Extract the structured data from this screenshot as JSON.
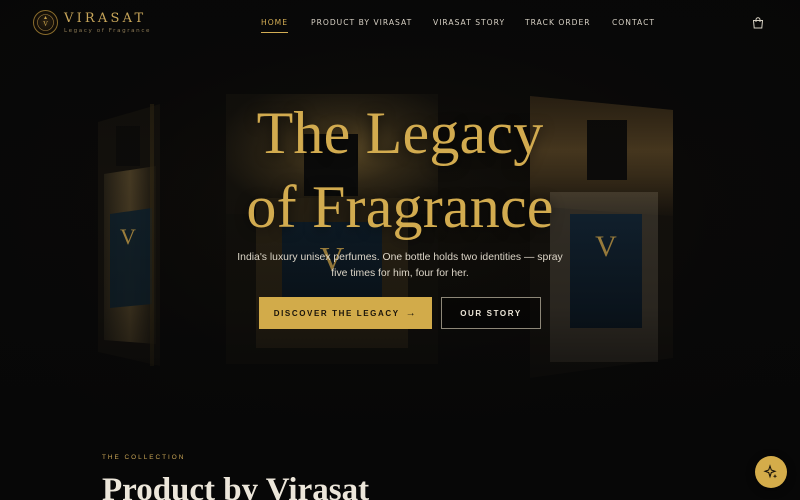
{
  "brand": {
    "name": "VIRASAT",
    "tagline": "Legacy of Fragrance",
    "badge_letter": "V",
    "accent_color": "#d2ab4f"
  },
  "nav": {
    "items": [
      {
        "label": "HOME",
        "active": true
      },
      {
        "label": "PRODUCT BY VIRASAT",
        "active": false
      },
      {
        "label": "VIRASAT STORY",
        "active": false
      },
      {
        "label": "TRACK ORDER",
        "active": false
      },
      {
        "label": "CONTACT",
        "active": false
      }
    ],
    "cart_icon": "shopping-bag-icon"
  },
  "hero": {
    "title_line1": "The Legacy",
    "title_line2": "of Fragrance",
    "subtitle": "India's luxury unisex perfumes. One bottle holds two identities — spray five times for him, four for her.",
    "primary_cta": "DISCOVER THE LEGACY",
    "primary_cta_icon": "arrow-right-icon",
    "secondary_cta": "OUR STORY",
    "bottle_label_letter": "V"
  },
  "collection": {
    "eyebrow": "THE COLLECTION",
    "title": "Product by Virasat"
  },
  "fab": {
    "icon": "sparkles-icon"
  }
}
